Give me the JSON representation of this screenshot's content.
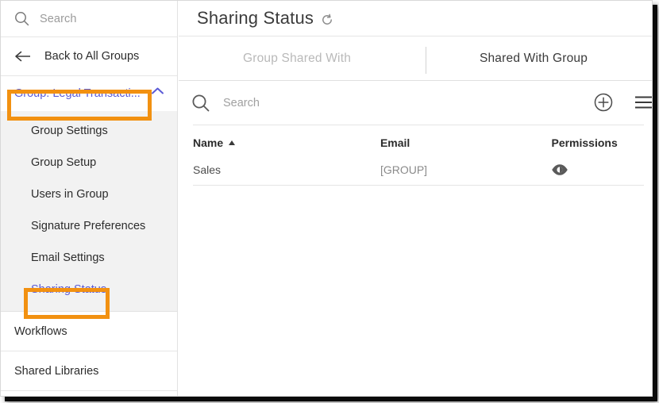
{
  "sidebar": {
    "search": {
      "placeholder": "Search",
      "icon": "search-icon"
    },
    "back": {
      "label": "Back to All Groups",
      "icon": "arrow-left-icon"
    },
    "group": {
      "label": "Group: Legal Transacti...",
      "icon": "chevron-up-icon",
      "highlighted": true,
      "highlight_color": "#f29111",
      "link_color": "#5b5bd6"
    },
    "submenu": [
      {
        "label": "Group Settings",
        "selected": false
      },
      {
        "label": "Group Setup",
        "selected": false
      },
      {
        "label": "Users in Group",
        "selected": false
      },
      {
        "label": "Signature Preferences",
        "selected": false
      },
      {
        "label": "Email Settings",
        "selected": false
      },
      {
        "label": "Sharing Status",
        "selected": true,
        "highlighted": true
      }
    ],
    "items": [
      {
        "label": "Workflows"
      },
      {
        "label": "Shared Libraries"
      }
    ]
  },
  "main": {
    "header": {
      "title": "Sharing Status",
      "refresh_icon": "refresh-icon"
    },
    "tabs": [
      {
        "label": "Group Shared With",
        "active": false
      },
      {
        "label": "Shared With Group",
        "active": true
      }
    ],
    "toolbar": {
      "search_placeholder": "Search",
      "search_icon": "search-icon",
      "add_icon": "plus-circle-icon",
      "menu_icon": "hamburger-menu-icon"
    },
    "table": {
      "columns": [
        {
          "label": "Name",
          "sorted": "asc"
        },
        {
          "label": "Email",
          "sorted": "none"
        },
        {
          "label": "Permissions",
          "sorted": "none"
        }
      ],
      "rows": [
        {
          "name": "Sales",
          "email": "[GROUP]",
          "permission_icon": "eye-icon"
        }
      ]
    }
  }
}
